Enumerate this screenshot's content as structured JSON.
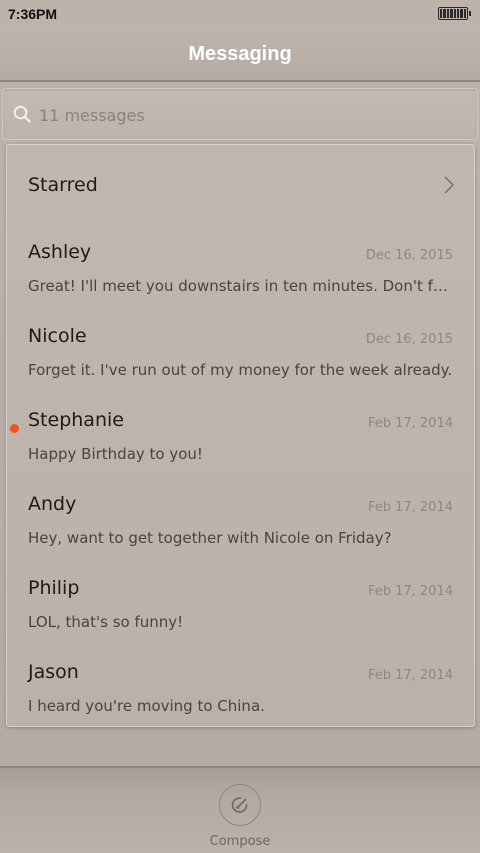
{
  "status_bar": {
    "time": "7:36PM"
  },
  "header": {
    "title": "Messaging"
  },
  "search": {
    "placeholder": "11 messages"
  },
  "starred": {
    "label": "Starred"
  },
  "messages": [
    {
      "sender": "Ashley",
      "date": "Dec 16, 2015",
      "preview": "Great! I'll meet you downstairs in ten minutes. Don't forget…",
      "unread": false
    },
    {
      "sender": "Nicole",
      "date": "Dec 16, 2015",
      "preview": "Forget it. I've run out of my money for the week already.",
      "unread": false
    },
    {
      "sender": "Stephanie",
      "date": "Feb 17, 2014",
      "preview": "Happy Birthday to you!",
      "unread": true
    },
    {
      "sender": "Andy",
      "date": "Feb 17, 2014",
      "preview": "Hey, want to get together with Nicole on Friday?",
      "unread": false
    },
    {
      "sender": "Philip",
      "date": "Feb 17, 2014",
      "preview": "LOL, that's so funny!",
      "unread": false
    },
    {
      "sender": "Jason",
      "date": "Feb 17, 2014",
      "preview": "I heard you're moving to China.",
      "unread": false
    }
  ],
  "footer": {
    "compose_label": "Compose"
  },
  "colors": {
    "unread_dot": "#f0551c",
    "title": "#ffffff"
  },
  "icons": {
    "search": "search-icon",
    "chevron": "chevron-right-icon",
    "compose": "compose-pencil-icon",
    "battery": "battery-icon"
  }
}
